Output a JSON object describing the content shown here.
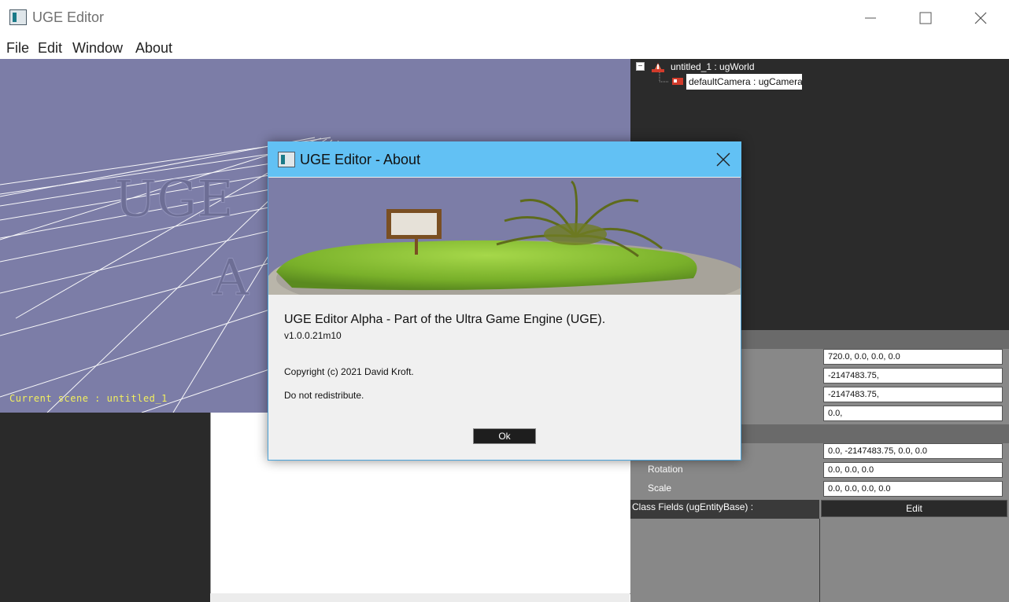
{
  "window": {
    "title": "UGE Editor",
    "controls": {
      "minimize_icon": "minimize-icon",
      "maximize_icon": "maximize-icon",
      "close_icon": "close-icon"
    }
  },
  "menu": [
    "File",
    "Edit",
    "Window",
    "About"
  ],
  "viewport": {
    "scene_label": "Current scene : untitled_1",
    "watermark": "UGE A",
    "background": "#7c7da7",
    "label_color": "#f2ef5e"
  },
  "scene_tree": {
    "root": "untitled_1 : ugWorld",
    "child": "defaultCamera : ugCamera",
    "collapse_glyph": "−"
  },
  "properties": {
    "fields_top": [
      "720.0, 0.0, 0.0, 0.0",
      "-2147483.75,",
      "-2147483.75,",
      "0.0,"
    ],
    "position_value": "0.0, -2147483.75, 0.0, 0.0",
    "rotation_label": "Rotation",
    "rotation_value": "0.0, 0.0, 0.0",
    "scale_label": "Scale",
    "scale_value": "0.0, 0.0, 0.0, 0.0",
    "class_fields_label": "Class Fields (ugEntityBase) :",
    "edit_label": "Edit"
  },
  "about_dialog": {
    "title": "UGE Editor - About",
    "headline": "UGE Editor Alpha - Part of the Ultra Game Engine (UGE).",
    "version": "v1.0.0.21m10",
    "copyright": "Copyright (c) 2021 David Kroft.",
    "notice": "Do not redistribute.",
    "ok_label": "Ok",
    "title_bar_color": "#62c1f4"
  }
}
